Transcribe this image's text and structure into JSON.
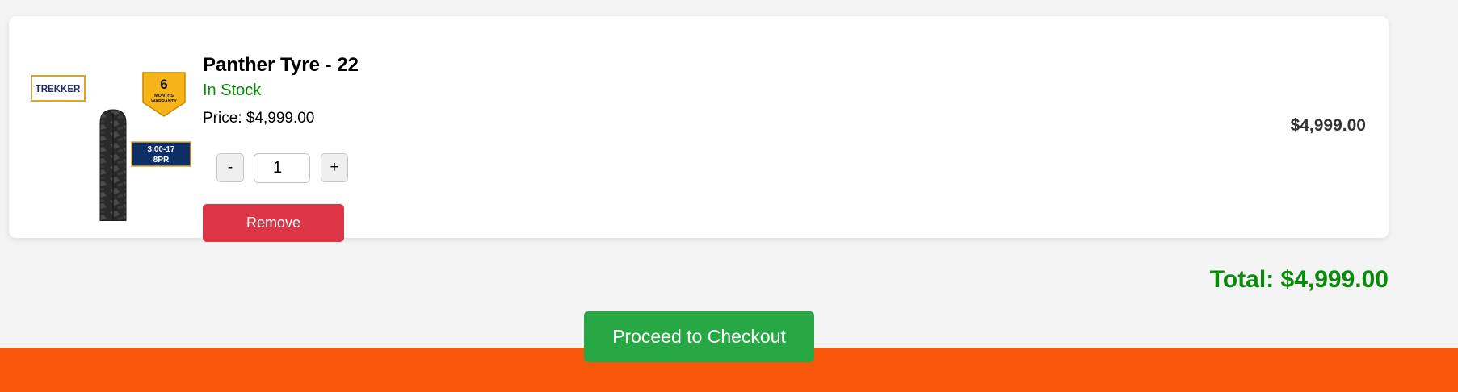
{
  "cart": {
    "items": [
      {
        "name": "Panther Tyre - 22",
        "stock_status": "In Stock",
        "price_label": "Price: $4,999.00",
        "quantity": "1",
        "decrement_label": "-",
        "increment_label": "+",
        "remove_label": "Remove",
        "line_total": "$4,999.00",
        "image": {
          "brand": "TREKKER",
          "warranty_number": "6",
          "warranty_line1": "MONTHS",
          "warranty_line2": "WARRANTY",
          "size_line1": "3.00-17",
          "size_line2": "8PR"
        }
      }
    ],
    "total_label": "Total: $4,999.00",
    "checkout_label": "Proceed to Checkout"
  },
  "colors": {
    "page_background": "#f4f4f4",
    "in_stock": "#0a8a0a",
    "total": "#0a8a0a",
    "remove_button": "#dc3545",
    "checkout_button": "#28a745",
    "footer_bar": "#f8570b"
  }
}
